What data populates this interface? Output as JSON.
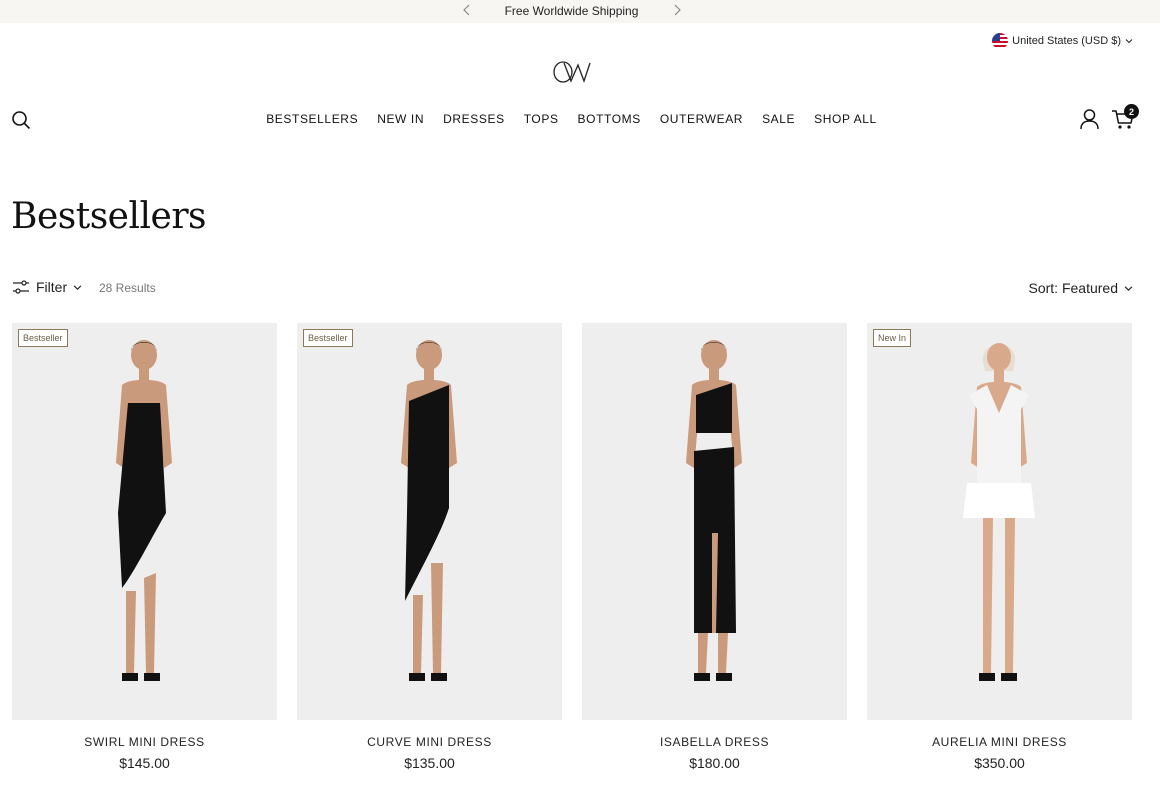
{
  "announcement": {
    "text": "Free Worldwide Shipping"
  },
  "locale": {
    "label": "United States (USD $)"
  },
  "header": {
    "nav": [
      "BESTSELLERS",
      "NEW IN",
      "DRESSES",
      "TOPS",
      "BOTTOMS",
      "OUTERWEAR",
      "SALE",
      "SHOP ALL"
    ],
    "cart_count": "2",
    "icons": [
      "search-icon",
      "account-icon",
      "cart-icon"
    ]
  },
  "collection": {
    "title": "Bestsellers",
    "filter_label": "Filter",
    "results": "28 Results",
    "sort_label": "Sort: Featured"
  },
  "products": [
    {
      "name": "SWIRL MINI DRESS",
      "price": "$145.00",
      "badge": "Bestseller",
      "color": "#111111"
    },
    {
      "name": "CURVE MINI DRESS",
      "price": "$135.00",
      "badge": "Bestseller",
      "color": "#111111"
    },
    {
      "name": "ISABELLA DRESS",
      "price": "$180.00",
      "badge": "",
      "color": "#111111"
    },
    {
      "name": "AURELIA MINI DRESS",
      "price": "$350.00",
      "badge": "New In",
      "color": "#f4f4f4"
    }
  ]
}
